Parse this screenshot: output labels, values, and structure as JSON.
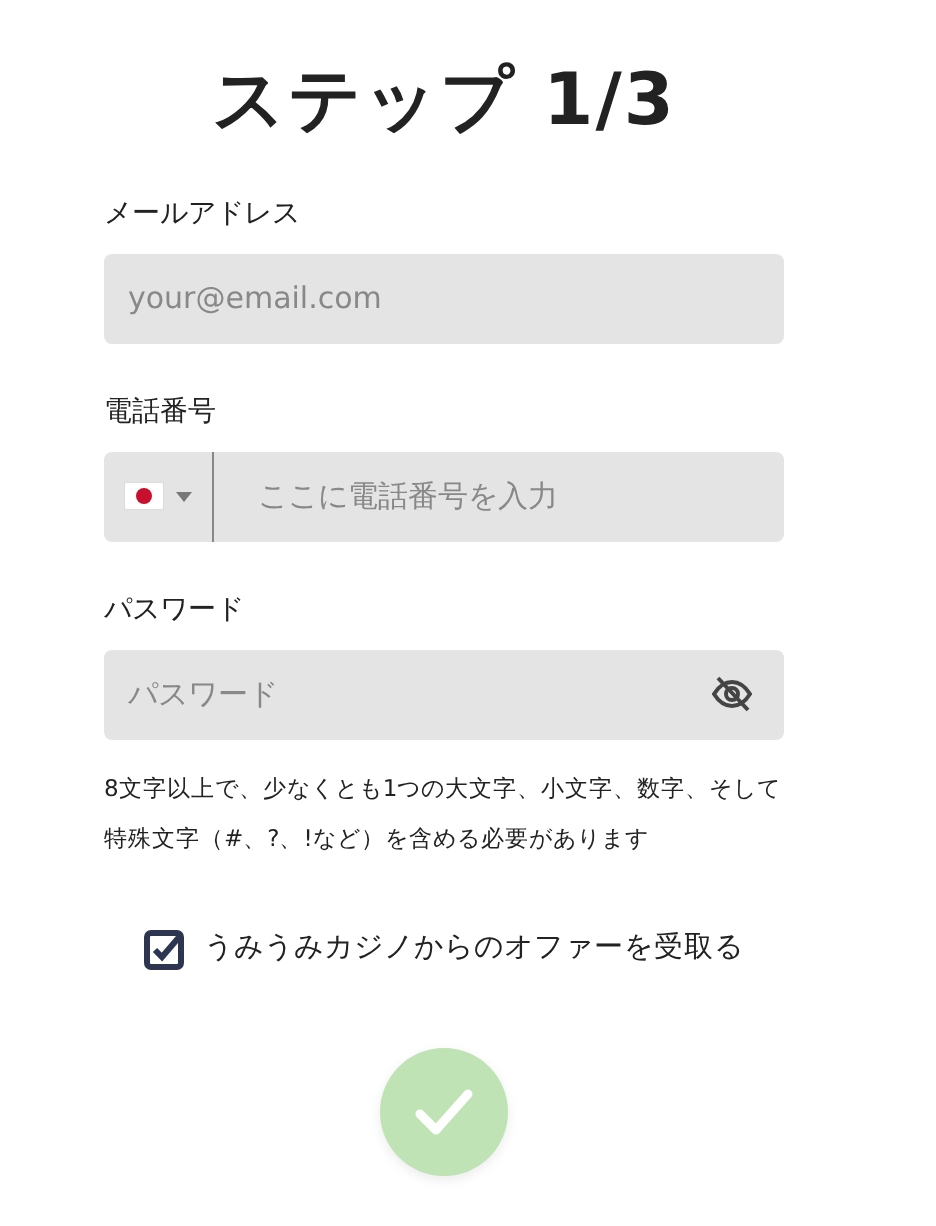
{
  "title": "ステップ 1/3",
  "fields": [
    {
      "kind": "email",
      "label": "メールアドレス",
      "placeholder": "your@email.com"
    },
    {
      "kind": "phone",
      "label": "電話番号",
      "placeholder": "ここに電話番号を入力"
    },
    {
      "kind": "password",
      "label": "パスワード",
      "placeholder": "パスワード"
    }
  ],
  "hint": "8文字以上で、少なくとも1つの大文字、小文字、数字、そして特殊文字（#、?、!など）を含める必要があります",
  "offer": {
    "label": "うみうみカジノからのオファーを受取る",
    "checked": true
  },
  "submit": {
    "disabled": true
  }
}
